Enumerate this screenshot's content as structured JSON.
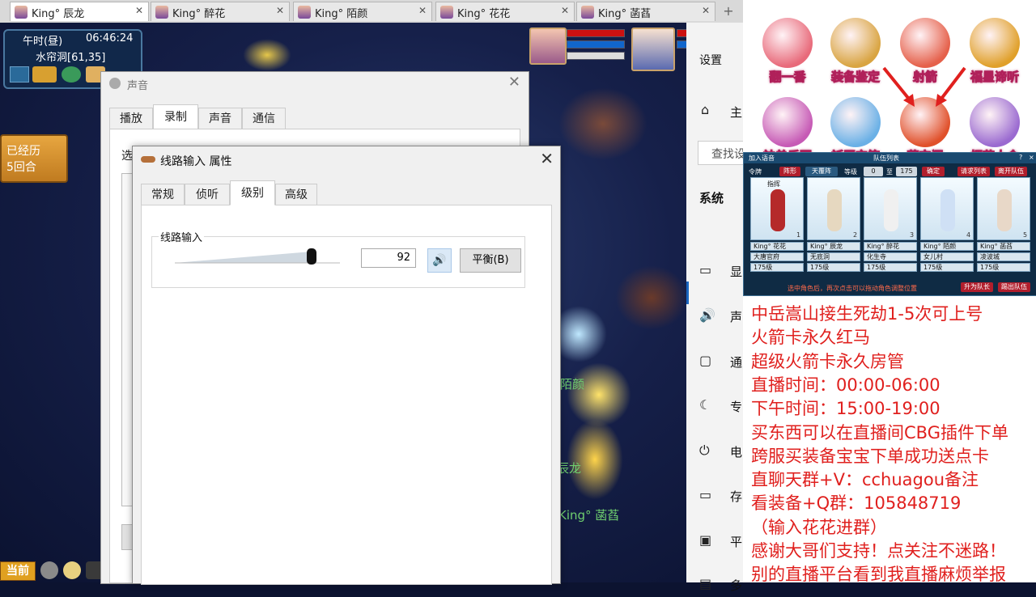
{
  "browser_tabs": [
    {
      "label": "King° 辰龙",
      "active": true
    },
    {
      "label": "King° 醉花",
      "active": false
    },
    {
      "label": "King° 陌颜",
      "active": false
    },
    {
      "label": "King° 花花",
      "active": false
    },
    {
      "label": "King° 菡萏",
      "active": false
    }
  ],
  "tab_close": "✕",
  "tab_add": "+",
  "game": {
    "time_period": "午时(昼)",
    "clock": "06:46:24",
    "location": "水帘洞[61,35]",
    "rounds_line1": "已经历",
    "rounds_line2": "5回合",
    "player_labels": [
      "陌颜",
      "辰龙",
      "King° 菡萏"
    ],
    "bottom_label": "当前"
  },
  "sound_dialog": {
    "title": "声音",
    "tabs": [
      "播放",
      "录制",
      "声音",
      "通信"
    ],
    "selected_tab": "录制",
    "partial_label": "选"
  },
  "line_in_dialog": {
    "title": "线路输入 属性",
    "tabs": [
      "常规",
      "侦听",
      "级别",
      "高级"
    ],
    "selected_tab": "级别",
    "group_label": "线路输入",
    "level": 92,
    "level_text": "92",
    "balance_button": "平衡(B)",
    "close": "✕"
  },
  "settings": {
    "title": "设置",
    "home_label": "主",
    "search_placeholder": "查找设",
    "section": "系统",
    "items": [
      {
        "icon": "display-icon",
        "glyph": "▭",
        "label": "显"
      },
      {
        "icon": "sound-icon",
        "glyph": "🔊",
        "label": "声"
      },
      {
        "icon": "notification-icon",
        "glyph": "▢",
        "label": "通"
      },
      {
        "icon": "focus-icon",
        "glyph": "☾",
        "label": "专"
      },
      {
        "icon": "power-icon",
        "glyph": "⏻",
        "label": "电"
      },
      {
        "icon": "storage-icon",
        "glyph": "▭",
        "label": "存"
      },
      {
        "icon": "tablet-icon",
        "glyph": "▣",
        "label": "平"
      },
      {
        "icon": "multitask-icon",
        "glyph": "▤",
        "label": "多"
      }
    ]
  },
  "activities": [
    {
      "name": "翻一番",
      "color": "#e86a7a"
    },
    {
      "name": "装备鉴定",
      "color": "#d9a441"
    },
    {
      "name": "射箭",
      "color": "#e5604a"
    },
    {
      "name": "福星谛听",
      "color": "#e0a02a"
    },
    {
      "name": "神兽乐园",
      "color": "#c65ab5"
    },
    {
      "name": "祈愿宝箱",
      "color": "#6ab0e6"
    },
    {
      "name": "藏宝阁",
      "color": "#e0502a"
    },
    {
      "name": "烟花大会",
      "color": "#9a6ad0"
    }
  ],
  "team_panel": {
    "join_voice": "加入语音",
    "title": "队伍列表",
    "ling": "令牌",
    "formation_btn": "阵形",
    "formation": "天覆阵",
    "level_label": "等级",
    "level_from": "0",
    "to": "至",
    "level_to": "175",
    "confirm": "确定",
    "request_list": "请求列表",
    "leave": "离开队伍",
    "leader_tag": "指挥",
    "members": [
      {
        "name": "King° 花花",
        "school": "大唐官府",
        "level": "175级",
        "index": "1"
      },
      {
        "name": "King° 辰龙",
        "school": "无底洞",
        "level": "175级",
        "index": "2"
      },
      {
        "name": "King° 醉花",
        "school": "化生寺",
        "level": "175级",
        "index": "3"
      },
      {
        "name": "King° 陌颜",
        "school": "女儿村",
        "level": "175级",
        "index": "4"
      },
      {
        "name": "King° 菡萏",
        "school": "凌波城",
        "level": "175级",
        "index": "5"
      }
    ],
    "hint": "选中角色后，再次点击可以拖动角色调整位置",
    "promote": "升为队长",
    "kick": "踢出队伍"
  },
  "ad_lines": [
    "中岳嵩山接生死劫1-5次可上号",
    "火箭卡永久红马",
    "超级火箭卡永久房管",
    "直播时间：00:00-06:00",
    "下午时间：15:00-19:00",
    "买东西可以在直播间CBG插件下单",
    "跨服买装备宝宝下单成功送点卡",
    "直聊天群+V：cchuagou备注",
    "看装备+Q群：105848719",
    "（输入花花进群）",
    "感谢大哥们支持！点关注不迷路！",
    "别的直播平台看到我直播麻烦举报"
  ],
  "ad_color": "#e0201e"
}
